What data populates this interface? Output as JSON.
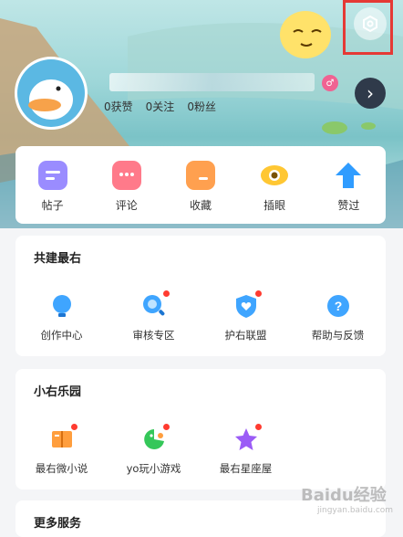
{
  "profile": {
    "badge_symbol": "♂",
    "stats": [
      {
        "count": "0",
        "label": "获赞"
      },
      {
        "count": "0",
        "label": "关注"
      },
      {
        "count": "0",
        "label": "粉丝"
      }
    ],
    "arrow": "›"
  },
  "quick_actions": [
    {
      "label": "帖子",
      "icon": "post-icon",
      "color": "#9a8cff"
    },
    {
      "label": "评论",
      "icon": "comment-icon",
      "color": "#ff7a8a"
    },
    {
      "label": "收藏",
      "icon": "folder-icon",
      "color": "#ffa04f"
    },
    {
      "label": "插眼",
      "icon": "eye-icon",
      "color": "#ffc733"
    },
    {
      "label": "赞过",
      "icon": "upvote-icon",
      "color": "#2f9cff"
    }
  ],
  "sections": {
    "build": {
      "title": "共建最右",
      "items": [
        {
          "label": "创作中心",
          "icon": "lightbulb-icon",
          "dot": false
        },
        {
          "label": "审核专区",
          "icon": "magnifier-icon",
          "dot": true
        },
        {
          "label": "护右联盟",
          "icon": "shield-heart-icon",
          "dot": true
        },
        {
          "label": "帮助与反馈",
          "icon": "help-icon",
          "dot": false
        }
      ]
    },
    "fun": {
      "title": "小右乐园",
      "items": [
        {
          "label": "最右微小说",
          "icon": "book-icon",
          "dot": true
        },
        {
          "label": "yo玩小游戏",
          "icon": "game-icon",
          "dot": true
        },
        {
          "label": "最右星座屋",
          "icon": "star-icon",
          "dot": true
        }
      ]
    },
    "more": {
      "title": "更多服务"
    }
  },
  "watermark": {
    "brand": "Baidu经验",
    "url": "jingyan.baidu.com"
  }
}
